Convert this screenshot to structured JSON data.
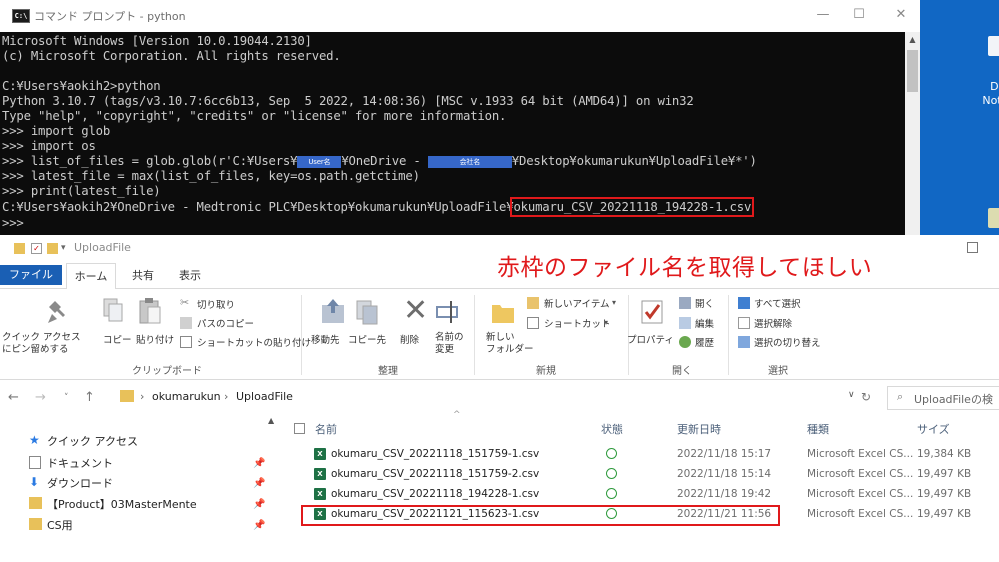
{
  "cmd": {
    "title": "コマンド プロンプト - python",
    "icon_text": "C:\\",
    "win_controls": [
      "—",
      "☐",
      "✕"
    ],
    "lines": [
      {
        "t": "Microsoft Windows [Version 10.0.19044.2130]"
      },
      {
        "t": "(c) Microsoft Corporation. All rights reserved."
      },
      {
        "t": ""
      },
      {
        "t": "C:¥Users¥aokih2>python"
      },
      {
        "t": "Python 3.10.7 (tags/v3.10.7:6cc6b13, Sep  5 2022, 14:08:36) [MSC v.1933 64 bit (AMD64)] on win32"
      },
      {
        "t": "Type \"help\", \"copyright\", \"credits\" or \"license\" for more information."
      },
      {
        "t": ">>> import glob"
      },
      {
        "t": ">>> import os"
      },
      {
        "a": ">>> list_of_files = glob.glob(r'C:¥Users¥",
        "r1": "User名",
        "b": "¥OneDrive - ",
        "r2": "会社名",
        "c": "¥Desktop¥okumarukun¥UploadFile¥*')"
      },
      {
        "t": ">>> latest_file = max(list_of_files, key=os.path.getctime)"
      },
      {
        "t": ">>> print(latest_file)"
      },
      {
        "a": "C:¥Users¥aokih2¥OneDrive - Medtronic PLC¥Desktop¥okumarukun¥UploadFile¥",
        "hl": "okumaru_CSV_20221118_194228-1.csv"
      },
      {
        "t": ">>>"
      }
    ]
  },
  "desktop": {
    "labels": [
      "Der",
      "Notific"
    ]
  },
  "explorer": {
    "title": "UploadFile",
    "annotation": "赤枠のファイル名を取得してほしい",
    "tabs": [
      "ファイル",
      "ホーム",
      "共有",
      "表示"
    ],
    "ribbon": {
      "pin_label": "クイック アクセス\nにピン留めする",
      "copy": "コピー",
      "paste": "貼り付け",
      "cut": "切り取り",
      "copy_path": "パスのコピー",
      "paste_shortcut": "ショートカットの貼り付け",
      "group_clipboard": "クリップボード",
      "move_to": "移動先",
      "copy_to": "コピー先",
      "delete": "削除",
      "rename": "名前の\n変更",
      "group_organize": "整理",
      "new_folder": "新しい\nフォルダー",
      "new_item": "新しいアイテム",
      "shortcut": "ショートカット",
      "group_new": "新規",
      "properties": "プロパティ",
      "open": "開く",
      "edit": "編集",
      "history": "履歴",
      "group_open": "開く",
      "select_all": "すべて選択",
      "select_none": "選択解除",
      "invert": "選択の切り替え",
      "group_select": "選択"
    },
    "address": {
      "crumbs": [
        "okumarukun",
        "UploadFile"
      ],
      "search_placeholder": "UploadFileの検"
    },
    "nav": [
      {
        "label": "クイック アクセス"
      },
      {
        "label": "ドキュメント"
      },
      {
        "label": "ダウンロード"
      },
      {
        "label": "【Product】03MasterMente"
      },
      {
        "label": "CS用"
      }
    ],
    "columns": [
      "名前",
      "状態",
      "更新日時",
      "種類",
      "サイズ"
    ],
    "files": [
      {
        "name": "okumaru_CSV_20221118_151759-1.csv",
        "date": "2022/11/18 15:17",
        "type": "Microsoft Excel CS...",
        "size": "19,384 KB"
      },
      {
        "name": "okumaru_CSV_20221118_151759-2.csv",
        "date": "2022/11/18 15:14",
        "type": "Microsoft Excel CS...",
        "size": "19,497 KB"
      },
      {
        "name": "okumaru_CSV_20221118_194228-1.csv",
        "date": "2022/11/18 19:42",
        "type": "Microsoft Excel CS...",
        "size": "19,497 KB"
      },
      {
        "name": "okumaru_CSV_20221121_115623-1.csv",
        "date": "2022/11/21 11:56",
        "type": "Microsoft Excel CS...",
        "size": "19,497 KB"
      }
    ]
  },
  "colors": {
    "accent": "#1a5fb4",
    "highlight": "#e0191b",
    "console_bg": "#0c0c0c",
    "console_fg": "#cccccc"
  }
}
